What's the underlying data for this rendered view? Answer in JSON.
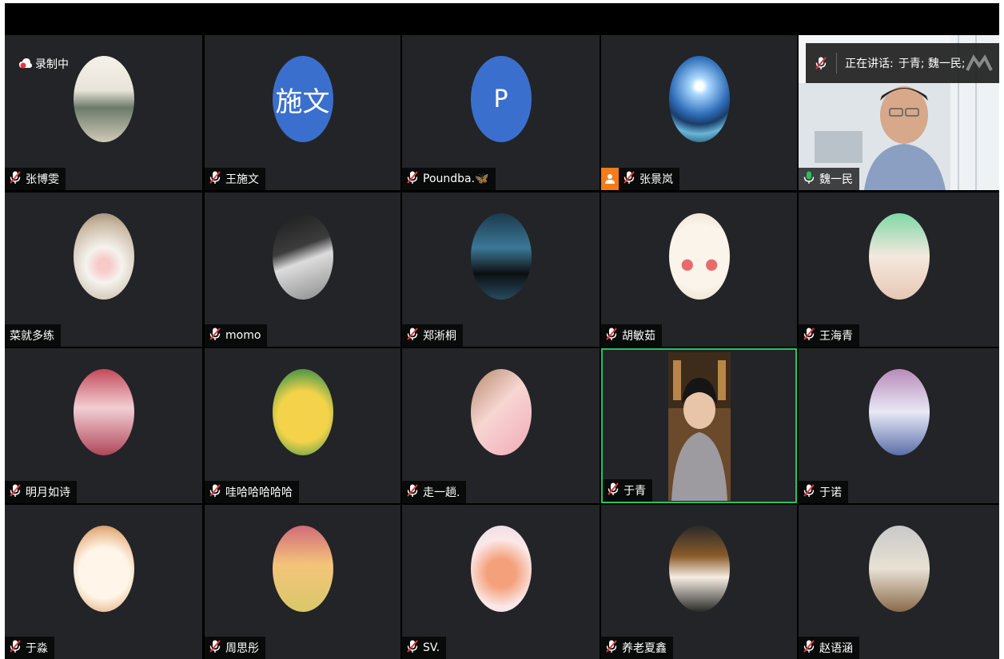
{
  "recording": {
    "label": "录制中"
  },
  "speaking": {
    "label": "正在讲话:",
    "names": "于青; 魏一民;"
  },
  "colors": {
    "tile_bg": "#232427",
    "active_border": "#22c55e",
    "host_badge": "#f27b1a",
    "muted_mic": "#e03a3a",
    "active_mic": "#22c55e"
  },
  "participants": [
    {
      "name": "张博雯",
      "mic": "muted",
      "avatar": "photo-person"
    },
    {
      "name": "王施文",
      "mic": "muted",
      "avatar": "letter",
      "initials": "施文",
      "avatar_color": "#3b6fce"
    },
    {
      "name": "Poundba.🦋",
      "mic": "muted",
      "avatar": "letter",
      "initials": "P",
      "avatar_color": "#3b6fce"
    },
    {
      "name": "张景岚",
      "mic": "muted",
      "avatar": "photo-landscape",
      "host": true
    },
    {
      "name": "魏一民",
      "mic": "active",
      "avatar": "video-camera"
    },
    {
      "name": "菜就多练",
      "mic": "none",
      "avatar": "photo-cat"
    },
    {
      "name": "momo",
      "mic": "muted",
      "avatar": "photo-person-dark"
    },
    {
      "name": "郑淅桐",
      "mic": "muted",
      "avatar": "photo-silhouette"
    },
    {
      "name": "胡敏茹",
      "mic": "muted",
      "avatar": "photo-bunny"
    },
    {
      "name": "王海青",
      "mic": "muted",
      "avatar": "photo-anime-green"
    },
    {
      "name": "明月如诗",
      "mic": "muted",
      "avatar": "photo-anime-pink"
    },
    {
      "name": "哇哈哈哈哈哈",
      "mic": "muted",
      "avatar": "photo-yellow-toy"
    },
    {
      "name": "走一趟.",
      "mic": "muted",
      "avatar": "photo-bear-pig"
    },
    {
      "name": "于青",
      "mic": "muted",
      "avatar": "video-person",
      "active": true
    },
    {
      "name": "于诺",
      "mic": "muted",
      "avatar": "photo-winter"
    },
    {
      "name": "于淼",
      "mic": "muted",
      "avatar": "photo-sheep"
    },
    {
      "name": "周思彤",
      "mic": "muted",
      "avatar": "photo-rabbit"
    },
    {
      "name": "SV.",
      "mic": "muted",
      "avatar": "photo-paw"
    },
    {
      "name": "养老夏鑫",
      "mic": "muted",
      "avatar": "photo-dog"
    },
    {
      "name": "赵语涵",
      "mic": "muted",
      "avatar": "photo-figure"
    }
  ]
}
